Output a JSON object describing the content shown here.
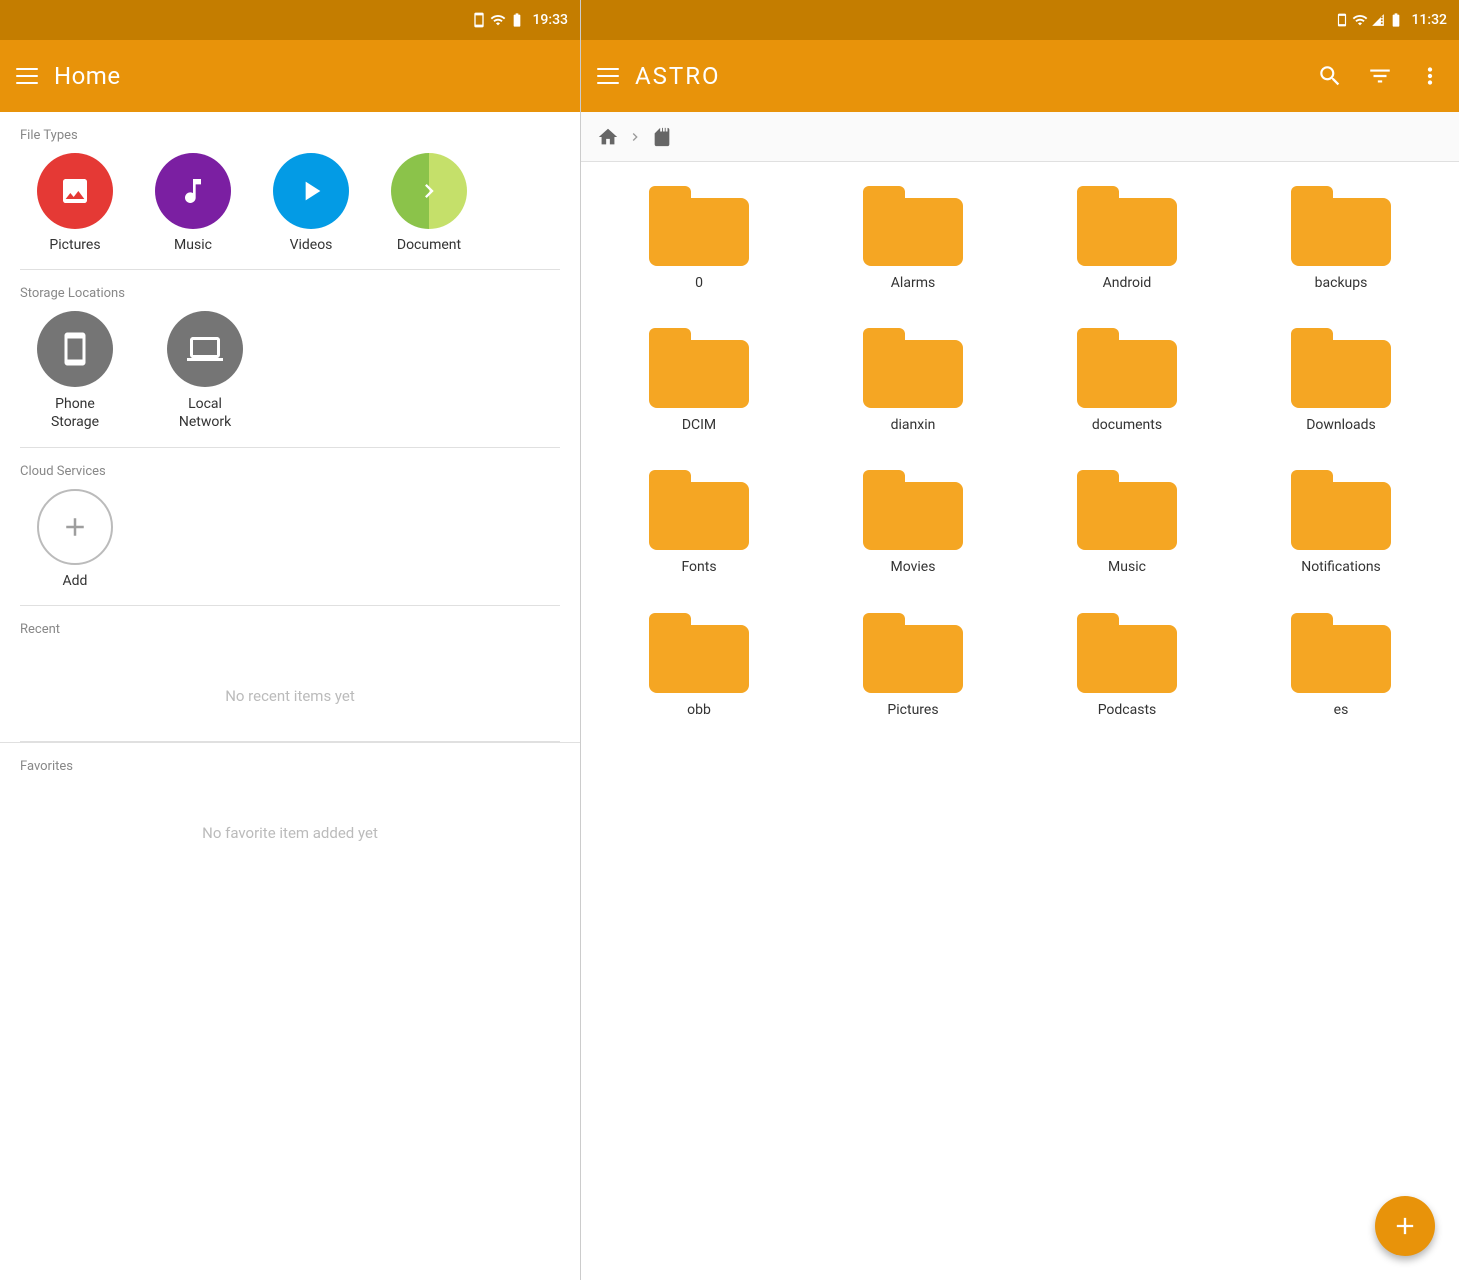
{
  "left": {
    "statusBar": {
      "time": "19:33"
    },
    "title": "Home",
    "sections": {
      "fileTypes": {
        "label": "File Types",
        "items": [
          {
            "id": "pictures",
            "label": "Pictures",
            "color": "red"
          },
          {
            "id": "music",
            "label": "Music",
            "color": "purple"
          },
          {
            "id": "videos",
            "label": "Videos",
            "color": "blue"
          },
          {
            "id": "documents",
            "label": "Document",
            "color": "more"
          }
        ]
      },
      "storageLocations": {
        "label": "Storage Locations",
        "items": [
          {
            "id": "phone-storage",
            "label": "Phone\nStorage"
          },
          {
            "id": "local-network",
            "label": "Local\nNetwork"
          }
        ]
      },
      "cloudServices": {
        "label": "Cloud Services",
        "addLabel": "Add"
      },
      "recent": {
        "label": "Recent",
        "emptyText": "No recent items yet"
      },
      "favorites": {
        "label": "Favorites",
        "emptyText": "No favorite item added yet"
      }
    }
  },
  "right": {
    "statusBar": {
      "time": "11:32"
    },
    "title": "ASTRO",
    "folders": [
      {
        "id": "0",
        "label": "0"
      },
      {
        "id": "alarms",
        "label": "Alarms"
      },
      {
        "id": "android",
        "label": "Android"
      },
      {
        "id": "backups",
        "label": "backups"
      },
      {
        "id": "dcim",
        "label": "DCIM"
      },
      {
        "id": "dianxin",
        "label": "dianxin"
      },
      {
        "id": "documents",
        "label": "documents"
      },
      {
        "id": "downloads",
        "label": "Downloads"
      },
      {
        "id": "fonts",
        "label": "Fonts"
      },
      {
        "id": "movies",
        "label": "Movies"
      },
      {
        "id": "music",
        "label": "Music"
      },
      {
        "id": "notifications",
        "label": "Notifications"
      },
      {
        "id": "obb",
        "label": "obb"
      },
      {
        "id": "pictures",
        "label": "Pictures"
      },
      {
        "id": "podcasts",
        "label": "Podcasts"
      },
      {
        "id": "ringtones",
        "label": "es"
      }
    ]
  }
}
